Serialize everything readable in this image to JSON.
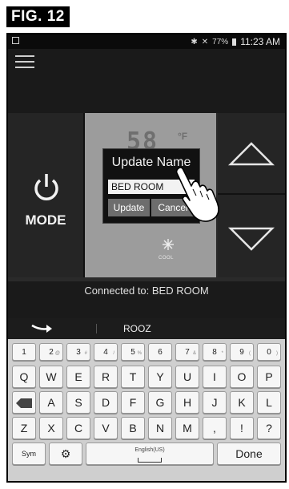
{
  "figure_label": "FIG. 12",
  "status_bar": {
    "battery": "77%",
    "time": "11:23 AM"
  },
  "thermostat": {
    "mode_label": "MODE",
    "temperature": "58",
    "unit": "°F",
    "mode_indicator": "COOL"
  },
  "dialog": {
    "title": "Update Name",
    "input_value": "BED ROOM",
    "update_button": "Update",
    "cancel_button": "Cancel"
  },
  "connection": {
    "text": "Connected to: BED ROOM"
  },
  "keyboard": {
    "suggestion": "ROOZ",
    "number_row": [
      "1",
      "2",
      "3",
      "4",
      "5",
      "6",
      "7",
      "8",
      "9",
      "0"
    ],
    "number_row_symbols": [
      "",
      "@",
      "#",
      "/",
      "%",
      "",
      "&",
      "*",
      "(",
      ")"
    ],
    "row1": [
      "Q",
      "W",
      "E",
      "R",
      "T",
      "Y",
      "U",
      "I",
      "O",
      "P"
    ],
    "row2": [
      "A",
      "S",
      "D",
      "F",
      "G",
      "H",
      "J",
      "K",
      "L"
    ],
    "done_label": "Done",
    "row3": [
      "Z",
      "X",
      "C",
      "V",
      "B",
      "N",
      "M",
      ",",
      "!",
      "?"
    ],
    "sym_label": "Sym",
    "space_label": "English(US)"
  }
}
